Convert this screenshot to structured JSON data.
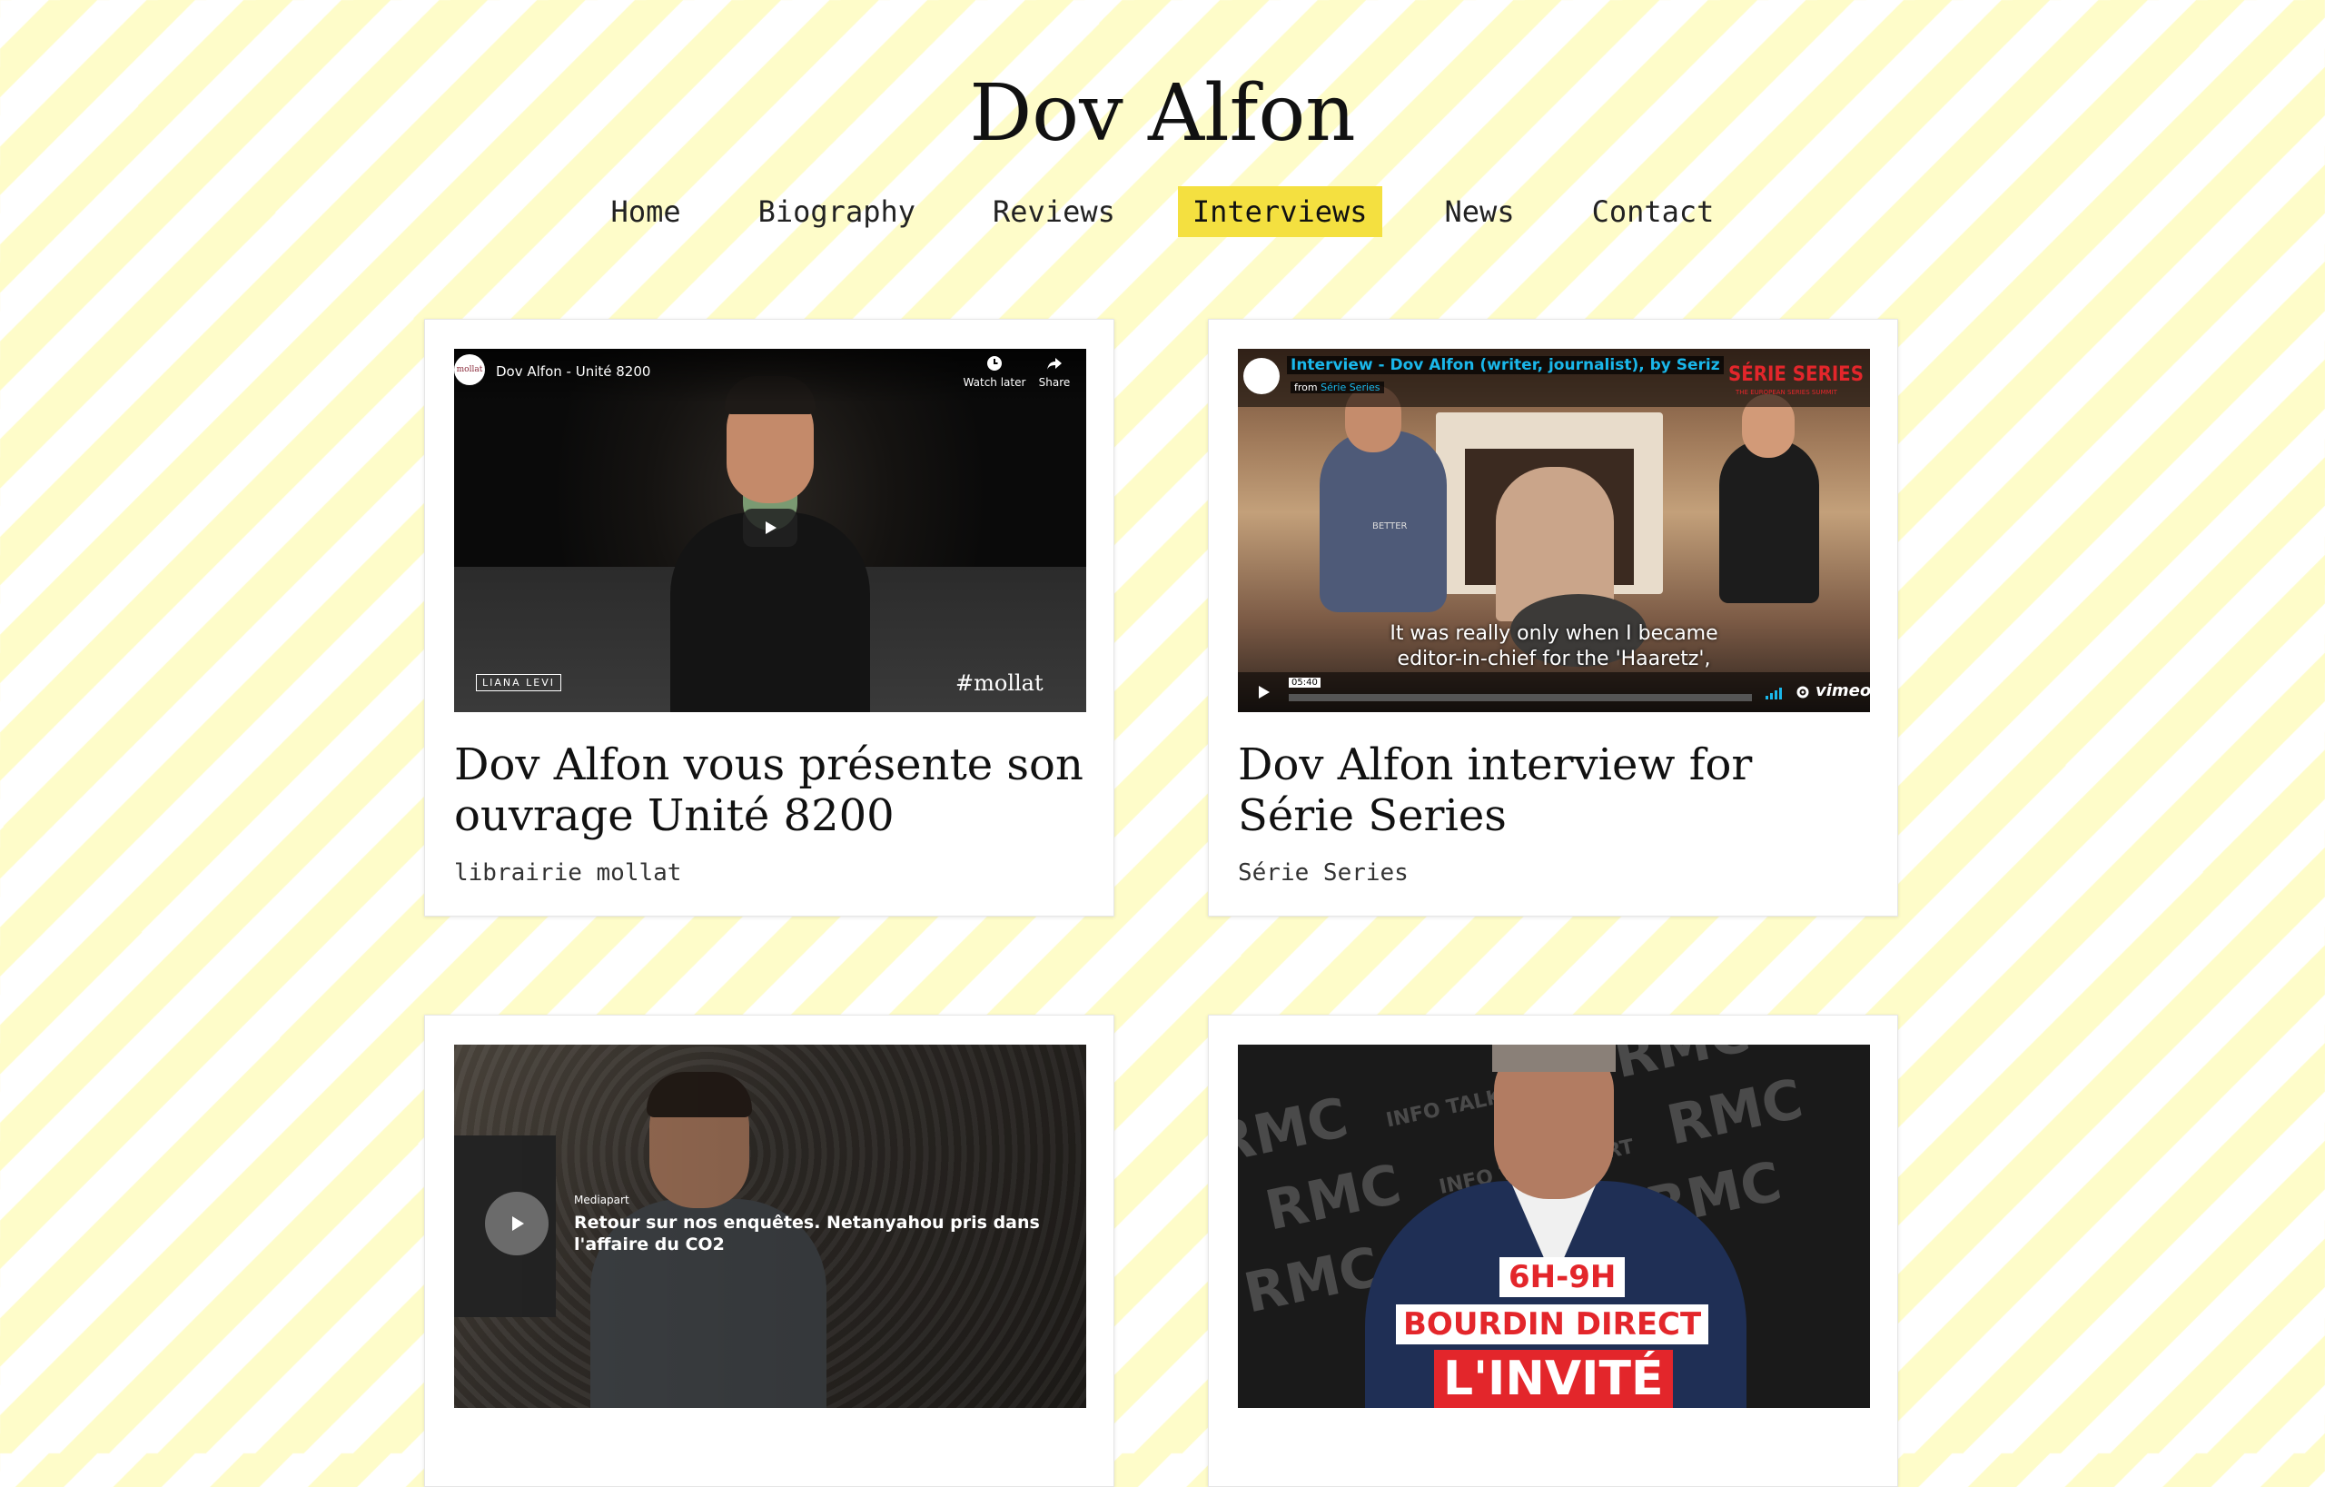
{
  "site": {
    "title": "Dov Alfon"
  },
  "nav": [
    {
      "label": "Home",
      "active": false
    },
    {
      "label": "Biography",
      "active": false
    },
    {
      "label": "Reviews",
      "active": false
    },
    {
      "label": "Interviews",
      "active": true
    },
    {
      "label": "News",
      "active": false
    },
    {
      "label": "Contact",
      "active": false
    }
  ],
  "cards": [
    {
      "title": "Dov Alfon vous présente son ouvrage Unité 8200",
      "source": "librairie mollat",
      "video": {
        "player": "youtube",
        "header": "Dov Alfon - Unité 8200",
        "watch_later": "Watch later",
        "share": "Share",
        "publisher_mark": "LIANA LEVI",
        "channel_mark": "#mollat",
        "channel_badge": "mollat"
      }
    },
    {
      "title": "Dov Alfon interview for Série Series",
      "source": "Série Series",
      "video": {
        "player": "vimeo",
        "header": "Interview - Dov Alfon (writer, journalist), by Seriz",
        "from_label": "from",
        "from_channel": "Série Series",
        "brand": "SÉRIE SERIES",
        "brand_sub": "THE EUROPEAN SERIES SUMMIT",
        "subtitle_line1": "It was really only when I became",
        "subtitle_line2": "editor-in-chief for the 'Haaretz',",
        "time": "05:40",
        "logo": "vimeo",
        "shirt_text": "BETTER"
      }
    },
    {
      "title": "",
      "source": "",
      "video": {
        "player": "mediapart",
        "channel": "Mediapart",
        "caption": "Retour sur nos enquêtes. Netanyahou pris dans l'affaire du CO2"
      }
    },
    {
      "title": "",
      "source": "",
      "video": {
        "player": "rmc",
        "bg_text": "RMC",
        "bg_sub": "INFO TALK SPORT",
        "time_slot": "6H-9H",
        "show": "BOURDIN DIRECT",
        "guest": "L'INVITÉ"
      }
    }
  ],
  "colors": {
    "stripe": "#fefcc9",
    "nav_active": "#f4e040",
    "vimeo_blue": "#1ab7ea",
    "rmc_red": "#e3262b"
  }
}
